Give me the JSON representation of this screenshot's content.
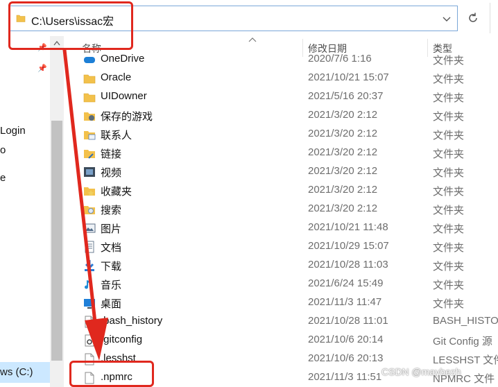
{
  "address_bar": {
    "path": "C:\\Users\\issac宏"
  },
  "nav": {
    "items": [
      {
        "label": "Login"
      },
      {
        "label": "o"
      },
      {
        "label": "e"
      }
    ],
    "drive_label": "ws (C:)"
  },
  "columns": {
    "name": "名称",
    "date": "修改日期",
    "type": "类型"
  },
  "files": [
    {
      "name": "OneDrive",
      "date": "2020/7/6 1:16",
      "type": "文件夹",
      "icon": "onedrive-icon"
    },
    {
      "name": "Oracle",
      "date": "2021/10/21 15:07",
      "type": "文件夹",
      "icon": "folder-icon"
    },
    {
      "name": "UIDowner",
      "date": "2021/5/16 20:37",
      "type": "文件夹",
      "icon": "folder-icon"
    },
    {
      "name": "保存的游戏",
      "date": "2021/3/20 2:12",
      "type": "文件夹",
      "icon": "saved-games-icon"
    },
    {
      "name": "联系人",
      "date": "2021/3/20 2:12",
      "type": "文件夹",
      "icon": "contacts-icon"
    },
    {
      "name": "链接",
      "date": "2021/3/20 2:12",
      "type": "文件夹",
      "icon": "links-icon"
    },
    {
      "name": "视频",
      "date": "2021/3/20 2:12",
      "type": "文件夹",
      "icon": "videos-icon"
    },
    {
      "name": "收藏夹",
      "date": "2021/3/20 2:12",
      "type": "文件夹",
      "icon": "favorites-icon"
    },
    {
      "name": "搜索",
      "date": "2021/3/20 2:12",
      "type": "文件夹",
      "icon": "searches-icon"
    },
    {
      "name": "图片",
      "date": "2021/10/21 11:48",
      "type": "文件夹",
      "icon": "pictures-icon"
    },
    {
      "name": "文档",
      "date": "2021/10/29 15:07",
      "type": "文件夹",
      "icon": "documents-icon"
    },
    {
      "name": "下载",
      "date": "2021/10/28 11:03",
      "type": "文件夹",
      "icon": "downloads-icon"
    },
    {
      "name": "音乐",
      "date": "2021/6/24 15:49",
      "type": "文件夹",
      "icon": "music-icon"
    },
    {
      "name": "桌面",
      "date": "2021/11/3 11:47",
      "type": "文件夹",
      "icon": "desktop-icon"
    },
    {
      "name": ".bash_history",
      "date": "2021/10/28 11:01",
      "type": "BASH_HISTO",
      "icon": "file-icon"
    },
    {
      "name": ".gitconfig",
      "date": "2021/10/6 20:14",
      "type": "Git Config 源",
      "icon": "gitconfig-icon"
    },
    {
      "name": ".lesshst",
      "date": "2021/10/6 20:13",
      "type": "LESSHST 文件",
      "icon": "file-icon"
    },
    {
      "name": ".npmrc",
      "date": "2021/11/3 11:51",
      "type": "NPMRC 文件",
      "icon": "file-icon"
    }
  ],
  "watermark": "CSDN @maybezh",
  "colors": {
    "annotation_red": "#e0281e",
    "folder_yellow": "#f3c14b",
    "selection_blue": "#cce8ff"
  }
}
